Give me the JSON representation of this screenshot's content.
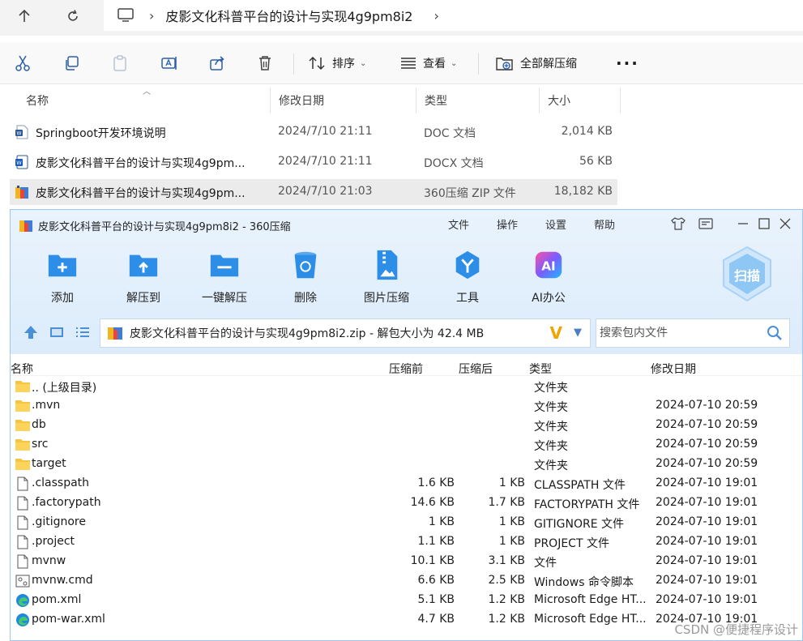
{
  "explorer": {
    "path": "皮影文化科普平台的设计与实现4g9pm8i2",
    "commands": {
      "sort": "排序",
      "view": "查看",
      "extract_all": "全部解压缩"
    },
    "columns": {
      "name": "名称",
      "modified": "修改日期",
      "type": "类型",
      "size": "大小"
    },
    "files": [
      {
        "name": "Springboot开发环境说明",
        "modified": "2024/7/10 21:11",
        "type": "DOC 文档",
        "size": "2,014 KB",
        "icon": "word-doc-icon"
      },
      {
        "name": "皮影文化科普平台的设计与实现4g9pm...",
        "modified": "2024/7/10 21:11",
        "type": "DOCX 文档",
        "size": "56 KB",
        "icon": "word-docx-icon"
      },
      {
        "name": "皮影文化科普平台的设计与实现4g9pm...",
        "modified": "2024/7/10 21:03",
        "type": "360压缩 ZIP 文件",
        "size": "18,182 KB",
        "icon": "zip-archive-icon"
      }
    ]
  },
  "zip": {
    "title": "皮影文化科普平台的设计与实现4g9pm8i2 - 360压缩",
    "menu": [
      "文件",
      "操作",
      "设置",
      "帮助"
    ],
    "tools": [
      {
        "label": "添加",
        "icon": "add-folder-icon"
      },
      {
        "label": "解压到",
        "icon": "extract-to-icon"
      },
      {
        "label": "一键解压",
        "icon": "one-click-extract-icon"
      },
      {
        "label": "删除",
        "icon": "recycle-bin-icon"
      },
      {
        "label": "图片压缩",
        "icon": "image-compress-icon"
      },
      {
        "label": "工具",
        "icon": "tools-icon"
      },
      {
        "label": "AI办公",
        "icon": "ai-office-icon"
      }
    ],
    "scan_label": "扫描",
    "ai_text": "AI",
    "path_text": "皮影文化科普平台的设计与实现4g9pm8i2.zip - 解包大小为 42.4 MB",
    "search_placeholder": "搜索包内文件",
    "columns": {
      "name": "名称",
      "packed": "压缩前",
      "compressed": "压缩后",
      "type": "类型",
      "modified": "修改日期"
    },
    "rows": [
      {
        "name": ".. (上级目录)",
        "packed": "",
        "compressed": "",
        "type": "文件夹",
        "modified": "",
        "icon": "folder-icon"
      },
      {
        "name": ".mvn",
        "packed": "",
        "compressed": "",
        "type": "文件夹",
        "modified": "2024-07-10 20:59",
        "icon": "folder-icon"
      },
      {
        "name": "db",
        "packed": "",
        "compressed": "",
        "type": "文件夹",
        "modified": "2024-07-10 20:59",
        "icon": "folder-icon"
      },
      {
        "name": "src",
        "packed": "",
        "compressed": "",
        "type": "文件夹",
        "modified": "2024-07-10 20:59",
        "icon": "folder-icon"
      },
      {
        "name": "target",
        "packed": "",
        "compressed": "",
        "type": "文件夹",
        "modified": "2024-07-10 20:59",
        "icon": "folder-icon"
      },
      {
        "name": ".classpath",
        "packed": "1.6 KB",
        "compressed": "1 KB",
        "type": "CLASSPATH 文件",
        "modified": "2024-07-10 19:01",
        "icon": "file-icon"
      },
      {
        "name": ".factorypath",
        "packed": "14.6 KB",
        "compressed": "1.7 KB",
        "type": "FACTORYPATH 文件",
        "modified": "2024-07-10 19:01",
        "icon": "file-icon"
      },
      {
        "name": ".gitignore",
        "packed": "1 KB",
        "compressed": "1 KB",
        "type": "GITIGNORE 文件",
        "modified": "2024-07-10 19:01",
        "icon": "file-icon"
      },
      {
        "name": ".project",
        "packed": "1.1 KB",
        "compressed": "1 KB",
        "type": "PROJECT 文件",
        "modified": "2024-07-10 19:01",
        "icon": "file-icon"
      },
      {
        "name": "mvnw",
        "packed": "10.1 KB",
        "compressed": "3.1 KB",
        "type": "文件",
        "modified": "2024-07-10 19:01",
        "icon": "file-icon"
      },
      {
        "name": "mvnw.cmd",
        "packed": "6.6 KB",
        "compressed": "2.5 KB",
        "type": "Windows 命令脚本",
        "modified": "2024-07-10 19:01",
        "icon": "script-icon"
      },
      {
        "name": "pom.xml",
        "packed": "5.1 KB",
        "compressed": "1.2 KB",
        "type": "Microsoft Edge HT...",
        "modified": "2024-07-10 19:01",
        "icon": "edge-icon"
      },
      {
        "name": "pom-war.xml",
        "packed": "4.7 KB",
        "compressed": "1.2 KB",
        "type": "Microsoft Edge HT...",
        "modified": "2024-07-10 19:01",
        "icon": "edge-icon"
      }
    ]
  },
  "watermark": "CSDN @便捷程序设计",
  "colors": {
    "zip_accent": "#1e88e5",
    "zip_header_bg": "#e3effb",
    "selected_row": "#ebebeb"
  }
}
